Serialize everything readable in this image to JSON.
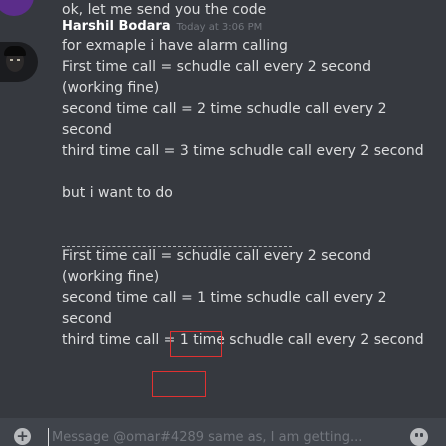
{
  "previous_message": {
    "text": "ok, let me send you the code"
  },
  "message": {
    "username": "Harshil Bodara",
    "timestamp": "Today at 3:06 PM",
    "lines": [
      "for exmaple i have alarm calling",
      "First time call = schudle call every 2 second",
      "(working fine)",
      "second time call = 2 time schudle call every 2",
      "second",
      "third time call = 3 time schudle call every 2 second",
      "",
      "but i want to do"
    ],
    "want_lines": [
      "First time call = schudle call every 2 second",
      "(working fine)",
      "second time call = 1 time schudle call every 2",
      "second",
      "third time call = 1 time schudle call every 2 second"
    ]
  },
  "composer": {
    "placeholder": "Message @omar#4289 same as, I am getting..."
  }
}
